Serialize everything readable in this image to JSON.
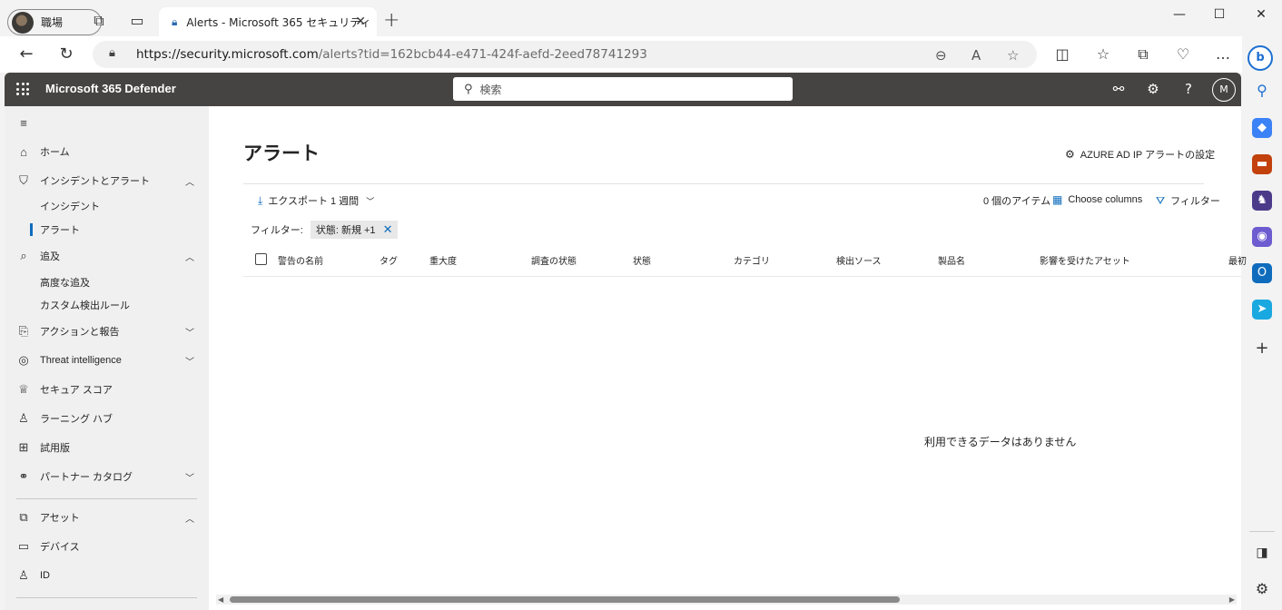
{
  "browser": {
    "profile_label": "職場",
    "tab_title": "Alerts - Microsoft 365 セキュリティ",
    "url_host": "https://security.microsoft.com",
    "url_path": "/alerts?tid=162bcb44-e471-424f-aefd-2eed78741293"
  },
  "app": {
    "name": "Microsoft 365 Defender",
    "search_placeholder": "検索",
    "avatar_initial": "M"
  },
  "nav": {
    "home": "ホーム",
    "incidents_alerts": "インシデントとアラート",
    "incidents": "インシデント",
    "alerts": "アラート",
    "hunting": "追及",
    "advanced_hunting": "高度な追及",
    "custom_rules": "カスタム検出ルール",
    "actions_reports": "アクションと報告",
    "threat_intel": "Threat intelligence",
    "secure_score": "セキュア スコア",
    "learning_hub": "ラーニング ハブ",
    "trials": "試用版",
    "partner_catalog": "パートナー カタログ",
    "assets": "アセット",
    "devices": "デバイス",
    "identities": "ID"
  },
  "page": {
    "title": "アラート",
    "azure_link": "AZURE AD IP アラートの設定",
    "export": "エクスポート",
    "period": "1 週間",
    "item_count": "0 個のアイテム",
    "choose_columns": "Choose columns",
    "filter_button": "フィルター",
    "filter_label": "フィルター:",
    "filter_chip": "状態: 新規 +1",
    "no_data": "利用できるデータはありません"
  },
  "table": {
    "columns": [
      "警告の名前",
      "タグ",
      "重大度",
      "調査の状態",
      "状態",
      "カテゴリ",
      "検出ソース",
      "製品名",
      "影響を受けたアセット",
      "最初"
    ]
  }
}
